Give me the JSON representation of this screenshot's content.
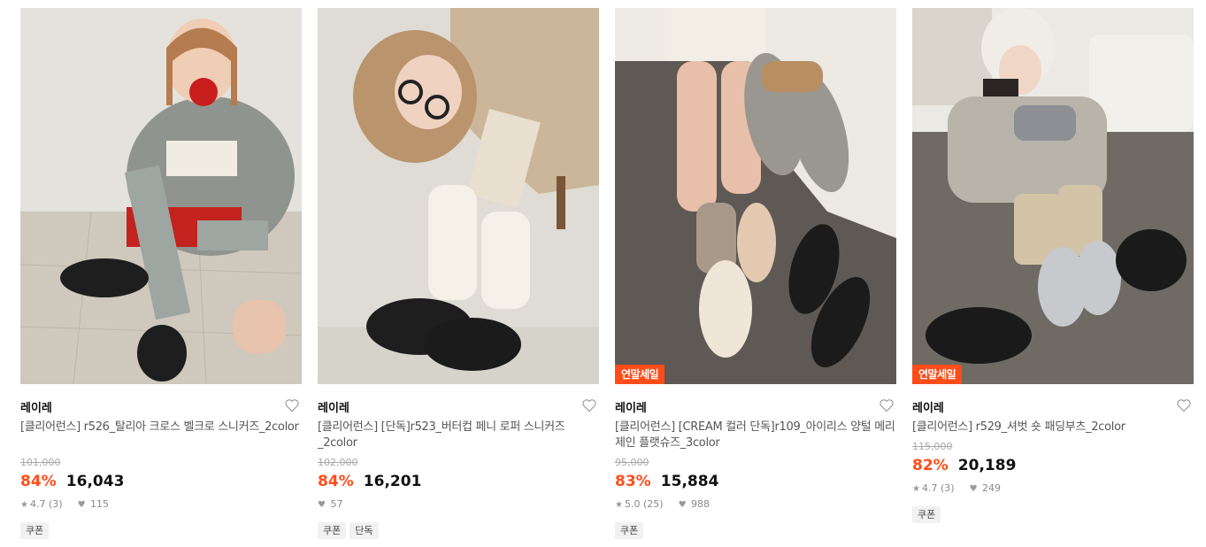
{
  "products": [
    {
      "image_alt": "t526",
      "badge": "",
      "brand": "레이레",
      "title": "[클리어런스] r526_탈리아 크로스 벨크로 스니커즈_2color",
      "original_price": "101,000",
      "discount": "84%",
      "price": "16,043",
      "rating": "4.7",
      "review_count": "(3)",
      "likes": "115",
      "tags": [
        "쿠폰"
      ]
    },
    {
      "image_alt": "r523",
      "badge": "",
      "brand": "레이레",
      "title": "[클리어런스] [단독]r523_버터컵 페니 로퍼 스니커즈_2color",
      "original_price": "102,000",
      "discount": "84%",
      "price": "16,201",
      "rating": "",
      "review_count": "",
      "likes": "57",
      "tags": [
        "쿠폰",
        "단독"
      ]
    },
    {
      "image_alt": "r109",
      "badge": "연말세일",
      "brand": "레이레",
      "title": "[클리어런스] [CREAM 컬러 단독]r109_아이리스 양털 메리제인 플랫슈즈_3color",
      "original_price": "95,000",
      "discount": "83%",
      "price": "15,884",
      "rating": "5.0",
      "review_count": "(25)",
      "likes": "988",
      "tags": [
        "쿠폰"
      ]
    },
    {
      "image_alt": "r529",
      "badge": "연말세일",
      "brand": "레이레",
      "title": "[클리어런스] r529_셔벗 숏 패딩부츠_2color",
      "original_price": "115,000",
      "discount": "82%",
      "price": "20,189",
      "rating": "4.7",
      "review_count": "(3)",
      "likes": "249",
      "tags": [
        "쿠폰"
      ]
    }
  ],
  "colors": {
    "accent": "#ff4d1a",
    "badge_bg": "#ff4d1a"
  }
}
